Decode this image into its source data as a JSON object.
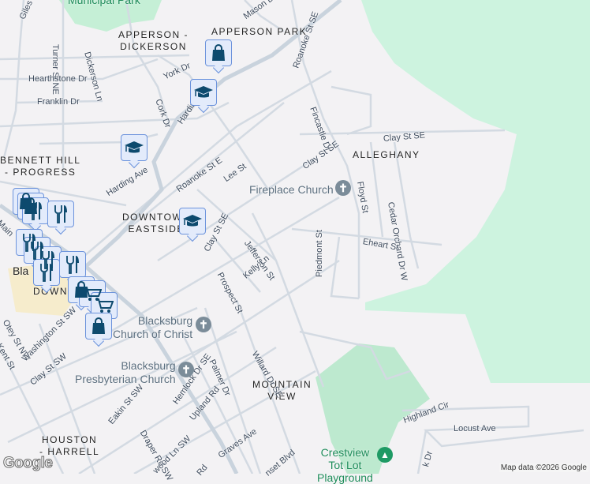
{
  "colors": {
    "background": "#f3f2f4",
    "park": "#cdf3df",
    "golf": "#b5e8c8",
    "road": "#d3dae2",
    "major_road": "#c9d3dd",
    "pin_fill": "#e3ebfb",
    "pin_border": "#6c93dc",
    "icon": "#0d4a6e"
  },
  "parks": {
    "municipal": "Municipal\nPark",
    "crestview": "Crestview\nTot Lot\nPlayground"
  },
  "neighborhoods": {
    "apperson_dickerson": "APPERSON -\nDICKERSON",
    "apperson_park": "APPERSON PARK",
    "bennett_hill": "BENNETT HILL\n- PROGRESS",
    "downtown_eastside": "DOWNTOWN\nEASTSIDE",
    "alleghany": "ALLEGHANY",
    "mountain_view": "MOUNTAIN\nVIEW",
    "houston_harrell": "HOUSTON\n- HARRELL",
    "downtown": "DOWN",
    "bla": "Bla"
  },
  "streets": {
    "giles": "Giles St",
    "mason": "Mason Dr",
    "turner": "Turner St NE",
    "dickerson": "Dickerson Ln",
    "hearthstone": "Hearthstone Dr",
    "franklin": "Franklin Dr",
    "york": "York Dr",
    "cork": "Cork Dr",
    "harding_main": "Harding Ave",
    "harding": "Harding Ave",
    "roanoke_e": "Roanoke St E",
    "lee": "Lee St",
    "roanoke_se": "Roanoke St SE",
    "fincastle": "Fincastle Dr",
    "clay_se": "Clay St SE",
    "clay_se2": "Clay St SE",
    "clay_se3": "Clay St SE",
    "floyd": "Floyd St",
    "cedar_orchard": "Cedar Orchard Dr W",
    "jefferson": "Jefferson St",
    "kelly": "Kelly Ln",
    "prospect": "Prospect St",
    "eheart": "Eheart St",
    "piedmont": "Piedmont St",
    "main": "Main",
    "otey": "Otey St NW",
    "kent": "Kent St",
    "washington": "Washington St SW",
    "clay_sw": "Clay St SW",
    "willard": "Willard Dr SE",
    "palmer": "Palmer Dr",
    "hemlock": "Hemlock Dr SE",
    "upland": "Upland Rd",
    "eakin": "Eakin St SW",
    "draper": "Draper Rd SW",
    "wood": "wood Ln SW",
    "graves": "Graves Ave",
    "sunset": "nset Blvd",
    "rd": "Rd",
    "highland": "Highland Cir",
    "locust": "Locust Ave",
    "k_dr": "k Dr"
  },
  "places": {
    "fireplace": "Fireplace Church",
    "church_christ": "Blacksburg\nChurch of Christ",
    "presbyterian": "Blacksburg\nPresbyterian Church"
  },
  "pins": [
    {
      "type": "shopping-bag"
    },
    {
      "type": "school"
    },
    {
      "type": "school"
    },
    {
      "type": "school"
    },
    {
      "type": "shopping-bag"
    },
    {
      "type": "shopping-bag"
    },
    {
      "type": "restaurant"
    },
    {
      "type": "restaurant"
    },
    {
      "type": "restaurant"
    },
    {
      "type": "restaurant"
    },
    {
      "type": "restaurant"
    },
    {
      "type": "restaurant"
    },
    {
      "type": "restaurant"
    },
    {
      "type": "shopping-bag"
    },
    {
      "type": "shopping-cart"
    },
    {
      "type": "shopping-cart"
    },
    {
      "type": "shopping-bag"
    }
  ],
  "attribution": "Map data ©2026 Google",
  "logo": "Google"
}
